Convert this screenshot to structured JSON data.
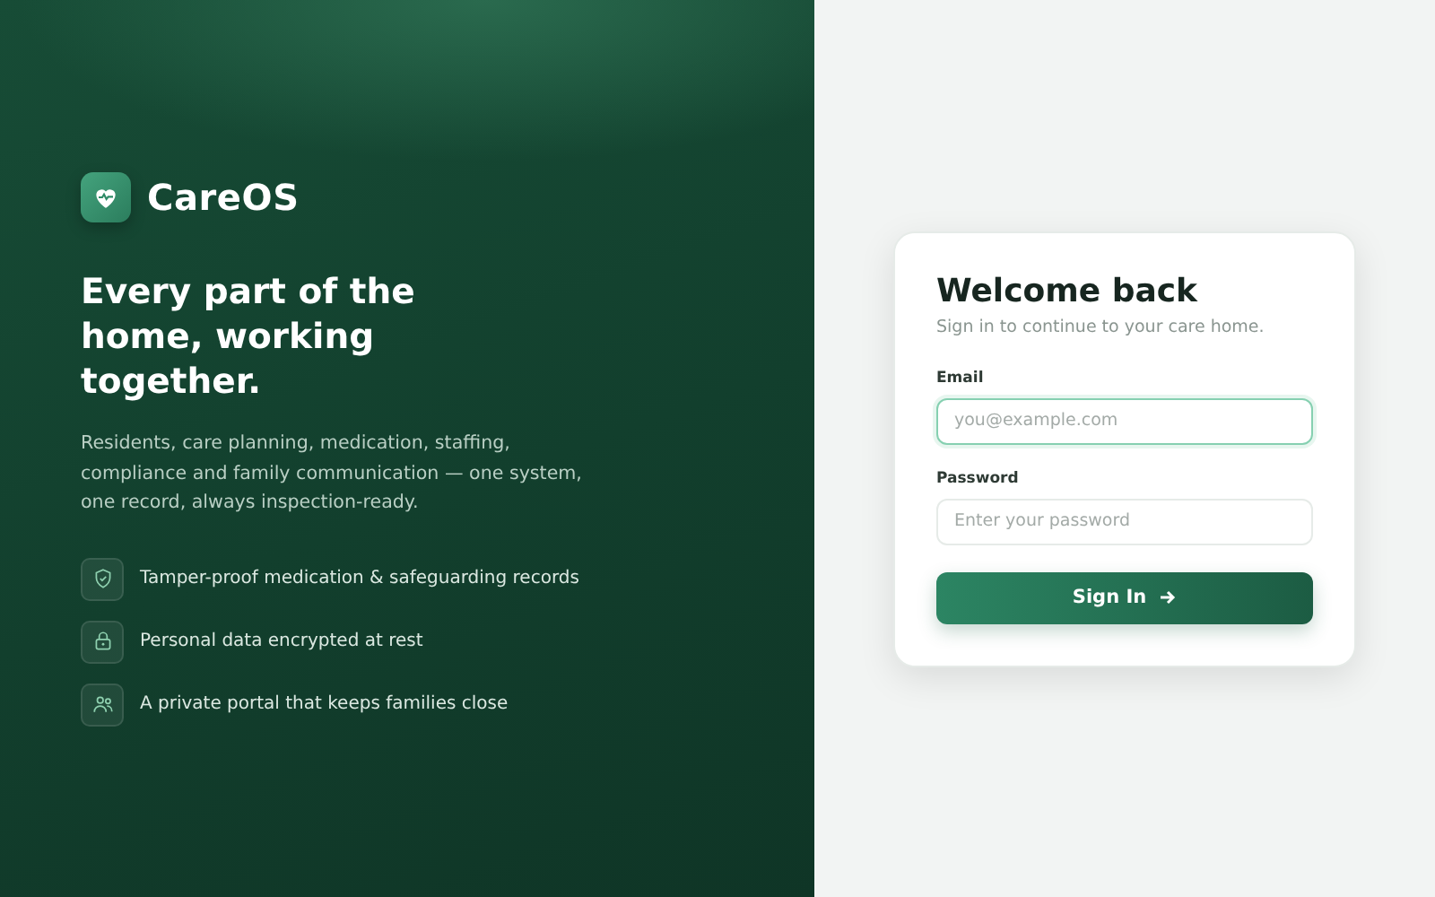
{
  "brand": {
    "name": "CareOS"
  },
  "hero": {
    "headline": "Every part of the home, working together.",
    "description": "Residents, care planning, medication, staffing, compliance and family communication — one system, one record, always inspection-ready."
  },
  "features": [
    {
      "kind": "shield",
      "text": "Tamper-proof medication & safeguarding records"
    },
    {
      "kind": "lock",
      "text": "Personal data encrypted at rest"
    },
    {
      "kind": "people",
      "text": "A private portal that keeps families close"
    }
  ],
  "login": {
    "title": "Welcome back",
    "subtitle": "Sign in to continue to your care home.",
    "fields": [
      {
        "label": "Email",
        "placeholder": "you@example.com",
        "focused": true
      },
      {
        "label": "Password",
        "placeholder": "Enter your password",
        "focused": false
      }
    ],
    "submit": "Sign In"
  }
}
